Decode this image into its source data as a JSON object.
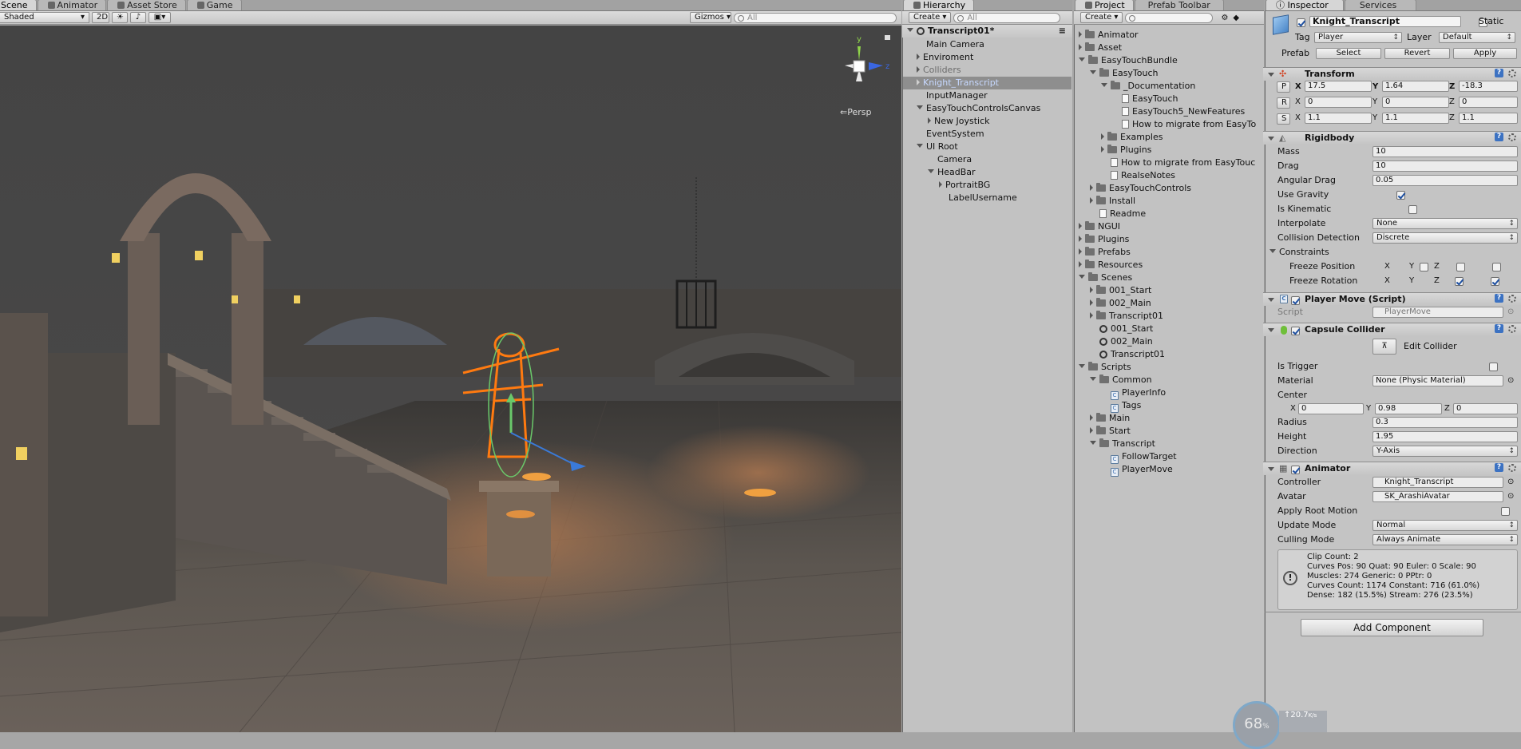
{
  "scene": {
    "tabs": [
      "Scene",
      "Animator",
      "Asset Store",
      "Game"
    ],
    "shading": "Shaded",
    "mode_2d": "2D",
    "gizmos": "Gizmos",
    "search_placeholder": "All",
    "persp": "Persp",
    "axis_y": "y",
    "axis_z": "z"
  },
  "hierarchy": {
    "tab": "Hierarchy",
    "create": "Create",
    "search_placeholder": "All",
    "scene_name": "Transcript01*",
    "items": [
      {
        "label": "Main Camera"
      },
      {
        "label": "Enviroment"
      },
      {
        "label": "Colliders"
      },
      {
        "label": "Knight_Transcript"
      },
      {
        "label": "InputManager"
      },
      {
        "label": "EasyTouchControlsCanvas"
      },
      {
        "label": "New Joystick"
      },
      {
        "label": "EventSystem"
      },
      {
        "label": "UI Root"
      },
      {
        "label": "Camera"
      },
      {
        "label": "HeadBar"
      },
      {
        "label": "PortraitBG"
      },
      {
        "label": "LabelUsername"
      }
    ]
  },
  "project": {
    "tabs": [
      "Project",
      "Prefab Toolbar"
    ],
    "create": "Create",
    "items": [
      {
        "label": "Animator"
      },
      {
        "label": "Asset"
      },
      {
        "label": "EasyTouchBundle"
      },
      {
        "label": "EasyTouch"
      },
      {
        "label": "_Documentation"
      },
      {
        "label": "EasyTouch"
      },
      {
        "label": "EasyTouch5_NewFeatures"
      },
      {
        "label": "How to migrate from EasyTo"
      },
      {
        "label": "Examples"
      },
      {
        "label": "Plugins"
      },
      {
        "label": "How to migrate from EasyTouc"
      },
      {
        "label": "RealseNotes"
      },
      {
        "label": "EasyTouchControls"
      },
      {
        "label": "Install"
      },
      {
        "label": "Readme"
      },
      {
        "label": "NGUI"
      },
      {
        "label": "Plugins"
      },
      {
        "label": "Prefabs"
      },
      {
        "label": "Resources"
      },
      {
        "label": "Scenes"
      },
      {
        "label": "001_Start"
      },
      {
        "label": "002_Main"
      },
      {
        "label": "Transcript01"
      },
      {
        "label": "001_Start"
      },
      {
        "label": "002_Main"
      },
      {
        "label": "Transcript01"
      },
      {
        "label": "Scripts"
      },
      {
        "label": "Common"
      },
      {
        "label": "PlayerInfo"
      },
      {
        "label": "Tags"
      },
      {
        "label": "Main"
      },
      {
        "label": "Start"
      },
      {
        "label": "Transcript"
      },
      {
        "label": "FollowTarget"
      },
      {
        "label": "PlayerMove"
      }
    ]
  },
  "inspector": {
    "tabs": [
      "Inspector",
      "Services"
    ],
    "object_name": "Knight_Transcript",
    "static": "Static",
    "tag_label": "Tag",
    "tag_value": "Player",
    "layer_label": "Layer",
    "layer_value": "Default",
    "prefab_label": "Prefab",
    "prefab_buttons": [
      "Select",
      "Revert",
      "Apply"
    ],
    "transform": {
      "title": "Transform",
      "P": "P",
      "R": "R",
      "S": "S",
      "x": "X",
      "y": "Y",
      "z": "Z",
      "pos": [
        "17.5",
        "1.64",
        "-18.3"
      ],
      "rot": [
        "0",
        "0",
        "0"
      ],
      "scale": [
        "1.1",
        "1.1",
        "1.1"
      ]
    },
    "rigidbody": {
      "title": "Rigidbody",
      "mass_label": "Mass",
      "mass": "10",
      "drag_label": "Drag",
      "drag": "10",
      "angular_label": "Angular Drag",
      "angular": "0.05",
      "gravity_label": "Use Gravity",
      "kinematic_label": "Is Kinematic",
      "interp_label": "Interpolate",
      "interp": "None",
      "collision_label": "Collision Detection",
      "collision": "Discrete",
      "constraints_label": "Constraints",
      "freeze_pos_label": "Freeze Position",
      "freeze_rot_label": "Freeze Rotation",
      "x": "X",
      "y": "Y",
      "z": "Z"
    },
    "playermove": {
      "title": "Player Move (Script)",
      "script_label": "Script",
      "script": "PlayerMove"
    },
    "capsule": {
      "title": "Capsule Collider",
      "edit": "Edit Collider",
      "trigger_label": "Is Trigger",
      "material_label": "Material",
      "material": "None (Physic Material)",
      "center_label": "Center",
      "cx": "0",
      "cy": "0.98",
      "cz": "0",
      "radius_label": "Radius",
      "radius": "0.3",
      "height_label": "Height",
      "height": "1.95",
      "direction_label": "Direction",
      "direction": "Y-Axis",
      "x": "X",
      "y": "Y",
      "z": "Z"
    },
    "animator": {
      "title": "Animator",
      "controller_label": "Controller",
      "controller": "Knight_Transcript",
      "avatar_label": "Avatar",
      "avatar": "SK_ArashiAvatar",
      "root_label": "Apply Root Motion",
      "update_label": "Update Mode",
      "update": "Normal",
      "culling_label": "Culling Mode",
      "culling": "Always Animate",
      "info": [
        "Clip Count: 2",
        "Curves Pos: 90 Quat: 90 Euler: 0 Scale: 90",
        "Muscles: 274 Generic: 0 PPtr: 0",
        "Curves Count: 1174 Constant: 716 (61.0%)",
        "Dense: 182 (15.5%) Stream: 276 (23.5%)"
      ]
    },
    "add_component": "Add Component"
  },
  "overlay": {
    "percent": "68",
    "speed": "20.7"
  }
}
